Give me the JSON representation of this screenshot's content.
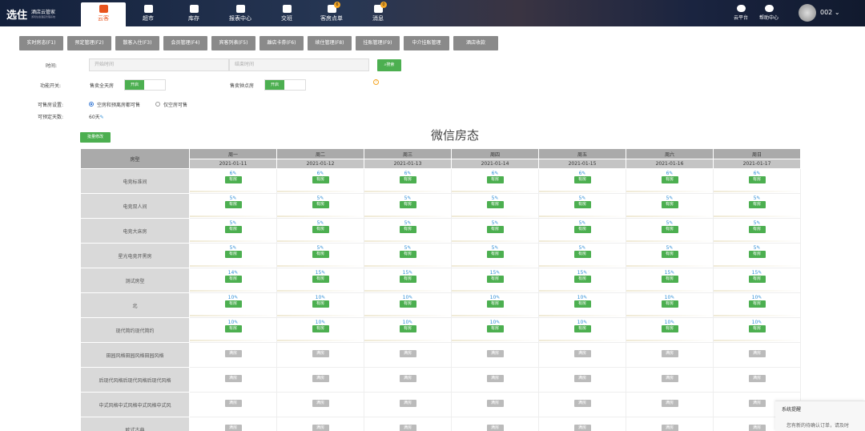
{
  "app": {
    "logo": "选住",
    "logo_sub": "酒店云管家",
    "logo_sub2": "游戏住宿酒店管理系统"
  },
  "nav": [
    {
      "label": "云客",
      "icon": "user-group-icon",
      "active": true,
      "badge": ""
    },
    {
      "label": "超市",
      "icon": "cart-icon",
      "badge": ""
    },
    {
      "label": "库存",
      "icon": "box-icon",
      "badge": ""
    },
    {
      "label": "报表中心",
      "icon": "chart-pie-icon",
      "badge": ""
    },
    {
      "label": "交班",
      "icon": "handover-icon",
      "badge": ""
    },
    {
      "label": "客房点单",
      "icon": "order-icon",
      "badge": "6"
    },
    {
      "label": "消息",
      "icon": "message-icon",
      "badge": "0"
    }
  ],
  "right": {
    "cloud": "云平台",
    "help": "帮助中心",
    "user": "002"
  },
  "tabs": [
    "实时房态(F1)",
    "预定管理(F2)",
    "散客入住(F3)",
    "会员管理(F4)",
    "宾客列表(F5)",
    "離店卡券(F6)",
    "续住管理(F8)",
    "挂账管理(F9)",
    "中介挂账管理",
    "酒店收款"
  ],
  "filter": {
    "time_label": "时间:",
    "start_placeholder": "开始时间",
    "end_placeholder": "结束时间",
    "search_btn": "搜索",
    "func_label": "功能开关:",
    "sell_full_day": "售卖全天房",
    "on": "开启",
    "sell_hourly": "售卖钟点房",
    "avail_label": "可售房设置:",
    "opt1": "空房和预离房都可售",
    "opt2": "仅空房可售",
    "days_label": "可预定天数:",
    "days_value": "60天"
  },
  "batch_btn": "批量修改",
  "title": "微信房态",
  "table": {
    "type_header": "房型",
    "weekdays": [
      "周一",
      "周二",
      "周三",
      "周四",
      "周五",
      "周六",
      "周日"
    ],
    "dates": [
      "2021-01-11",
      "2021-01-12",
      "2021-01-13",
      "2021-01-14",
      "2021-01-15",
      "2021-01-16",
      "2021-01-17"
    ],
    "rows": [
      {
        "name": "电竞标准间",
        "counts": [
          "6",
          "6",
          "6",
          "6",
          "6",
          "6",
          "6"
        ],
        "status": "有房"
      },
      {
        "name": "电竞双人间",
        "counts": [
          "5",
          "5",
          "5",
          "5",
          "5",
          "5",
          "5"
        ],
        "status": "有房"
      },
      {
        "name": "电竞大床房",
        "counts": [
          "5",
          "5",
          "5",
          "5",
          "5",
          "5",
          "5"
        ],
        "status": "有房"
      },
      {
        "name": "星光电竞开黑房",
        "counts": [
          "5",
          "5",
          "5",
          "5",
          "5",
          "5",
          "5"
        ],
        "status": "有房"
      },
      {
        "name": "测试房型",
        "counts": [
          "14",
          "15",
          "15",
          "15",
          "15",
          "15",
          "15"
        ],
        "status": "有房"
      },
      {
        "name": "北",
        "counts": [
          "10",
          "10",
          "10",
          "10",
          "10",
          "10",
          "10"
        ],
        "status": "有房"
      },
      {
        "name": "现代简约现代简约",
        "counts": [
          "10",
          "10",
          "10",
          "10",
          "10",
          "10",
          "10"
        ],
        "status": "有房"
      },
      {
        "name": "田园风格田园风格田园风格",
        "counts": [
          "",
          "",
          "",
          "",
          "",
          "",
          ""
        ],
        "status": "满房"
      },
      {
        "name": "后现代风格后现代风格后现代风格",
        "counts": [
          "",
          "",
          "",
          "",
          "",
          "",
          ""
        ],
        "status": "满房"
      },
      {
        "name": "中式风格中式风格中式风格中式风",
        "counts": [
          "",
          "",
          "",
          "",
          "",
          "",
          ""
        ],
        "status": "满房"
      },
      {
        "name": "欧式古典",
        "counts": [
          "",
          "",
          "",
          "",
          "",
          "",
          ""
        ],
        "status": "满房"
      }
    ]
  },
  "notice": {
    "title": "系统提醒",
    "body": "您有新的待确认订单，请及时"
  }
}
